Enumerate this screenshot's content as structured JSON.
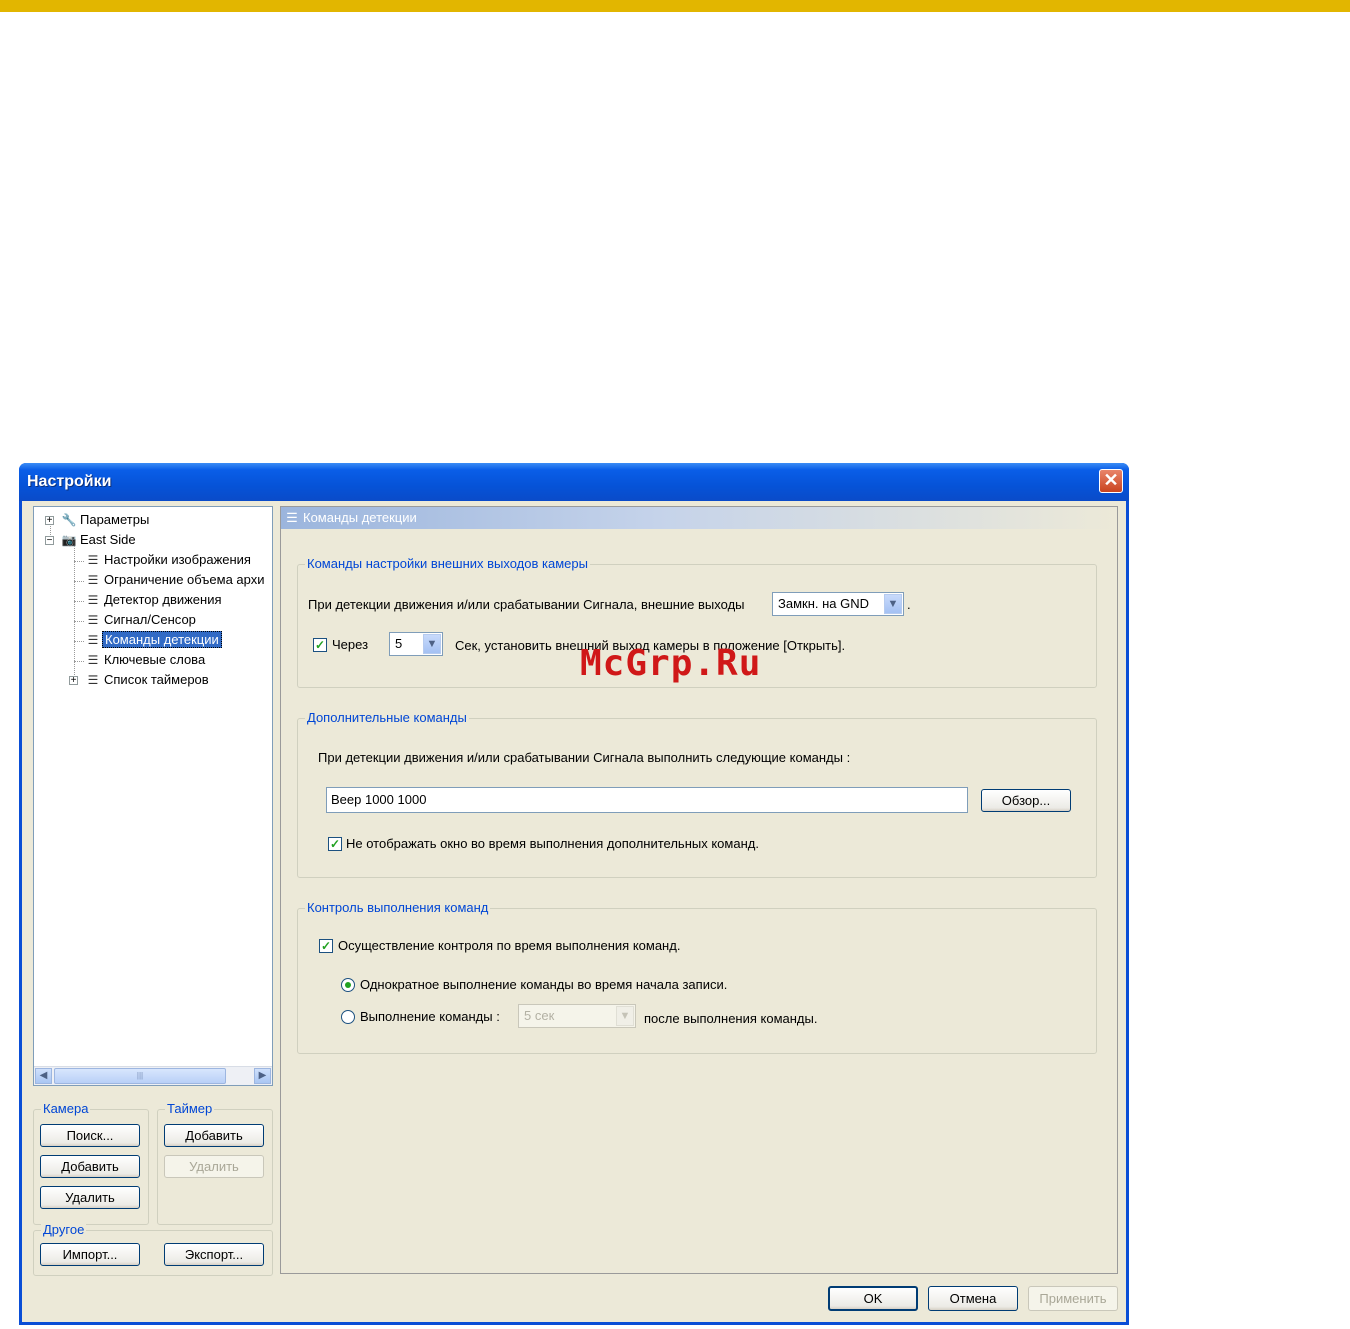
{
  "window": {
    "title": "Настройки"
  },
  "tree": {
    "items": [
      {
        "label": "Параметры",
        "icon": "wrench-icon",
        "expander": "+"
      },
      {
        "label": "East Side",
        "icon": "camera-icon",
        "expander": "−"
      },
      {
        "label": "Настройки изображения",
        "icon": "list-icon"
      },
      {
        "label": "Ограничение объема архи",
        "icon": "list-icon"
      },
      {
        "label": "Детектор движения",
        "icon": "list-icon"
      },
      {
        "label": "Сигнал/Сенсор",
        "icon": "list-icon"
      },
      {
        "label": "Команды детекции",
        "icon": "list-icon",
        "selected": true
      },
      {
        "label": "Ключевые слова",
        "icon": "list-icon"
      },
      {
        "label": "Список таймеров",
        "icon": "list-icon",
        "expander": "+"
      }
    ]
  },
  "camera_group": {
    "title": "Камера",
    "search": "Поиск...",
    "add": "Добавить",
    "delete": "Удалить"
  },
  "timer_group": {
    "title": "Таймер",
    "add": "Добавить",
    "delete": "Удалить"
  },
  "other_group": {
    "title": "Другое",
    "import": "Импорт...",
    "export": "Экспорт..."
  },
  "panel": {
    "title": "Команды детекции",
    "outputs_group": {
      "title": "Команды настройки внешних выходов камеры",
      "text": "При детекции движения и/или срабатывании Сигнала, внешние выходы",
      "output_value": "Замкн. на GND",
      "period": ".",
      "after_checked": true,
      "after_label": "Через",
      "seconds_value": "5",
      "after_text": "Сек, установить внешний выход камеры в положение [Открыть]."
    },
    "extra_group": {
      "title": "Дополнительные команды",
      "text": "При детекции движения и/или срабатывании Сигнала выполнить следующие команды :",
      "command_value": "Beep 1000 1000",
      "browse": "Обзор...",
      "hide_checked": true,
      "hide_label": "Не отображать окно во время выполнения дополнительных команд."
    },
    "control_group": {
      "title": "Контроль выполнения команд",
      "control_checked": true,
      "control_label": "Осуществление контроля по время выполнения команд.",
      "radio_once": "Однократное выполнение команды во время начала записи.",
      "radio_repeat": "Выполнение команды :",
      "repeat_value": "5 сек",
      "repeat_after": "после выполнения команды."
    }
  },
  "footer": {
    "ok": "OK",
    "cancel": "Отмена",
    "apply": "Применить"
  },
  "watermark": "McGrp.Ru"
}
